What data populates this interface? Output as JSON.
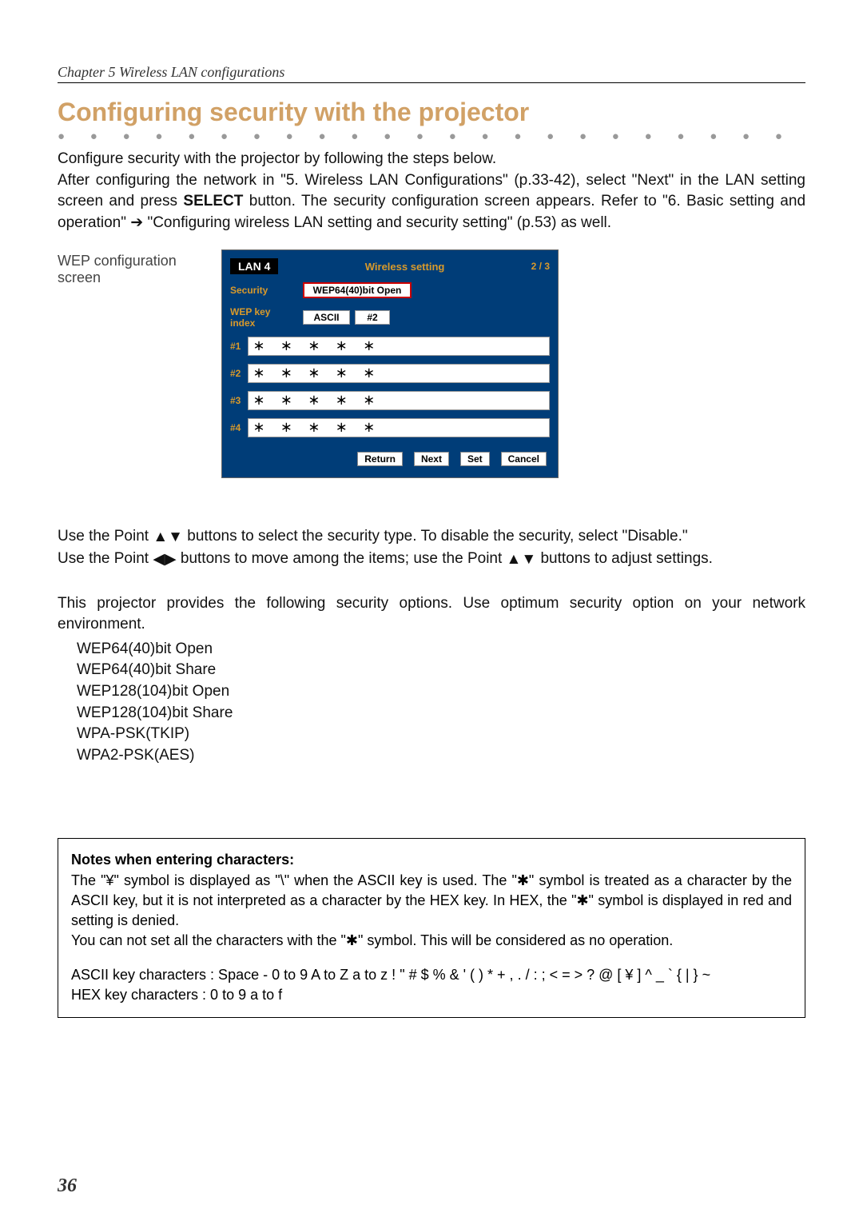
{
  "chapter_header": "Chapter 5 Wireless LAN configurations",
  "section_title": "Configuring security with the projector",
  "intro_1": "Configure security with the projector by following the steps below.",
  "intro_2a": "After configuring the network in \"5. Wireless LAN Configurations\" (p.33-42), select \"Next\" in the LAN setting screen and press ",
  "intro_2_select": "SELECT",
  "intro_2b": " button. The security configuration screen appears. Refer to \"6. Basic setting and operation\" ",
  "arrow": "➔",
  "intro_2c": " \"Configuring wireless LAN setting and security setting\" (p.53) as well.",
  "caption": "WEP configuration screen",
  "screen": {
    "lan": "LAN 4",
    "title": "Wireless setting",
    "page": "2 / 3",
    "labels": {
      "security": "Security",
      "keyindex": "WEP key index"
    },
    "security_value": "WEP64(40)bit Open",
    "keytype": "ASCII",
    "keysel": "#2",
    "keys": [
      {
        "idx": "#1",
        "val": "＊ ＊ ＊ ＊ ＊"
      },
      {
        "idx": "#2",
        "val": "＊ ＊ ＊ ＊ ＊"
      },
      {
        "idx": "#3",
        "val": "＊ ＊ ＊ ＊ ＊"
      },
      {
        "idx": "#4",
        "val": "＊ ＊ ＊ ＊ ＊"
      }
    ],
    "buttons": {
      "return": "Return",
      "next": "Next",
      "set": "Set",
      "cancel": "Cancel"
    }
  },
  "mid_1a": "Use the Point ",
  "mid_1b": " buttons to select the security type. To disable the security, select \"Disable.\"",
  "mid_2a": "Use the Point ",
  "mid_2b": " buttons to move among the items; use the Point ",
  "mid_2c": " buttons to adjust settings.",
  "options_intro": "This projector provides the following security options. Use optimum security option on your network environment.",
  "options": [
    "WEP64(40)bit Open",
    "WEP64(40)bit Share",
    "WEP128(104)bit Open",
    "WEP128(104)bit Share",
    "WPA-PSK(TKIP)",
    "WPA2-PSK(AES)"
  ],
  "notes": {
    "title": "Notes when entering characters:",
    "p1": "The \"¥\" symbol is displayed as \"\\\" when the ASCII key is used. The \"✱\" symbol is treated as a character by the ASCII key, but it is not interpreted as a character by the HEX key. In HEX, the \"✱\" symbol is displayed in red and setting is denied.",
    "p2": "You can not set all the characters with the \"✱\" symbol. This will be considered as no operation.",
    "ascii": "ASCII key characters : Space - 0 to 9 A to Z a to z ! \" # $ % & ' ( ) * + , . / : ; < = > ? @ [ ¥ ] ^ _ ` { | } ~",
    "hex": "HEX key characters : 0 to 9 a to f"
  },
  "page_number": "36",
  "glyphs": {
    "up": "▲",
    "down": "▼",
    "left": "◀",
    "right": "▶"
  }
}
